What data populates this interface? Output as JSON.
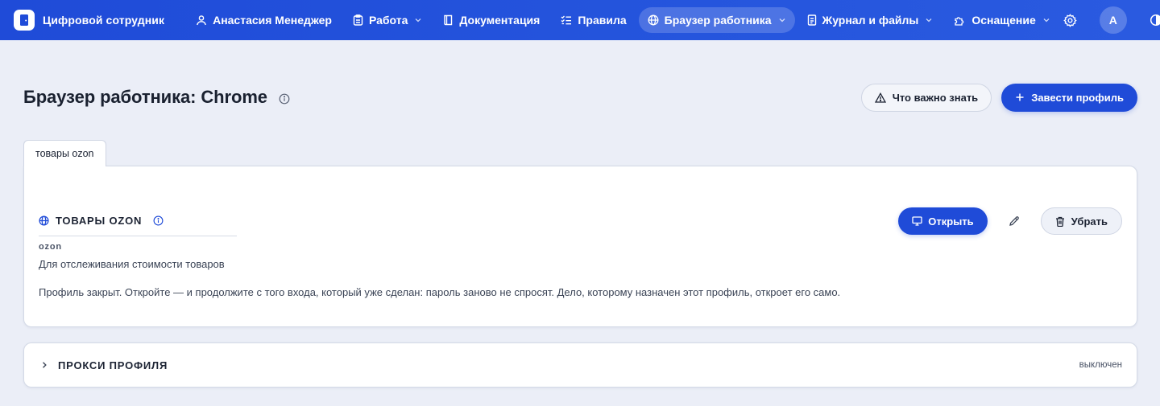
{
  "brand": {
    "name": "Цифровой сотрудник",
    "logo_icon": "door-icon"
  },
  "nav": {
    "items": [
      {
        "label": "Анастасия Менеджер",
        "icon": "user-icon",
        "dropdown": false,
        "active": false
      },
      {
        "label": "Работа",
        "icon": "clipboard-icon",
        "dropdown": true,
        "active": false
      },
      {
        "label": "Документация",
        "icon": "book-icon",
        "dropdown": false,
        "active": false
      },
      {
        "label": "Правила",
        "icon": "checklist-icon",
        "dropdown": false,
        "active": false
      },
      {
        "label": "Браузер работника",
        "icon": "globe-icon",
        "dropdown": true,
        "active": true
      },
      {
        "label": "Журнал и файлы",
        "icon": "file-icon",
        "dropdown": true,
        "active": false
      },
      {
        "label": "Оснащение",
        "icon": "puzzle-icon",
        "dropdown": true,
        "active": false
      }
    ]
  },
  "top_right": {
    "avatar_letter": "A",
    "settings_icon": "gear-icon",
    "theme_icon": "contrast-icon"
  },
  "page": {
    "title": "Браузер работника: Chrome",
    "important_button": "Что важно знать",
    "create_button": "Завести профиль"
  },
  "tabs": [
    {
      "label": "товары ozon",
      "active": true
    }
  ],
  "profile": {
    "name": "ТОВАРЫ OZON",
    "slug": "ozon",
    "description": "Для отслеживания стоимости товаров",
    "note": "Профиль закрыт. Откройте — и продолжите с того входа, который уже сделан: пароль заново не спросят. Дело, которому назначен этот профиль, откроет его само.",
    "open_button": "Открыть",
    "remove_button": "Убрать"
  },
  "proxy": {
    "title": "ПРОКСИ ПРОФИЛЯ",
    "status": "выключен"
  },
  "colors": {
    "primary": "#1f4bd8",
    "background": "#ebeef7",
    "card": "#ffffff"
  }
}
